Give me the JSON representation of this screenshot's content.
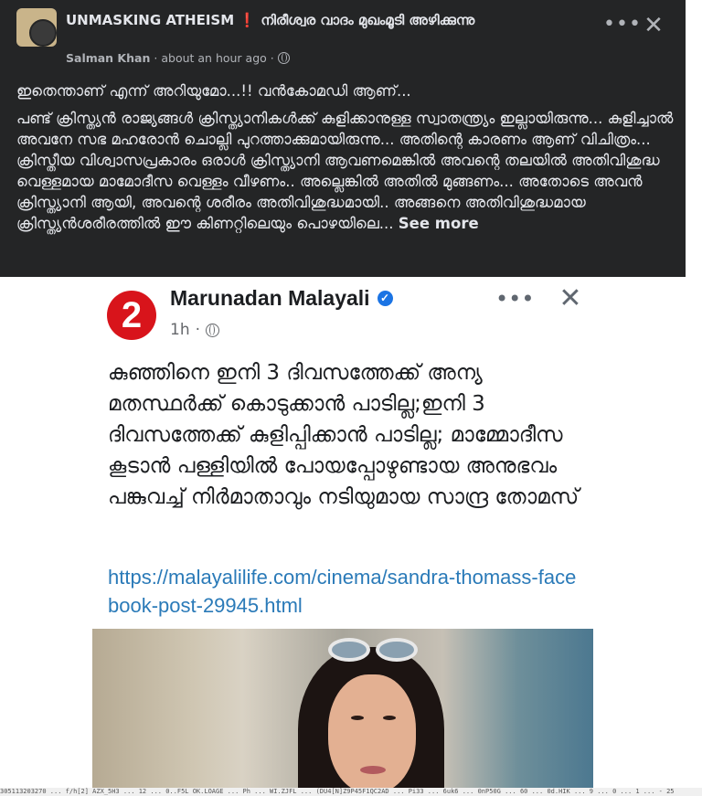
{
  "post": {
    "group_name": "UNMASKING ATHEISM",
    "group_mark": "❗",
    "group_subtitle": "നിരീശ്വര വാദം മുഖംമൂടി അഴിക്കുന്നു",
    "author": "Salman Khan",
    "separator": "·",
    "time": "about an hour ago",
    "line1": "ഇതെന്താണ് എന്ന് അറിയുമോ...!! വൻകോമഡി ആണ്...",
    "body": "പണ്ട് ക്രിസ്ത്യൻ രാജ്യങ്ങൾ ക്രിസ്ത്യാനികൾക്ക് കുളിക്കാനുള്ള സ്വാതന്ത്ര്യം ഇല്ലായിരുന്നു... കുളിച്ചാൽ അവനേ സഭ മഹരോൻ ചൊല്ലി പുറത്താക്കുമായിരുന്നു... അതിന്റെ കാരണം ആണ് വിചിത്രം... ക്രിസ്തീയ വിശ്വാസപ്രകാരം ഒരാൾ ക്രിസ്ത്യാനി ആവണമെങ്കിൽ അവന്റെ തലയിൽ അതിവിശുദ്ധ വെള്ളമായ മാമോദീസ വെള്ളം വീഴണം.. അല്ലെങ്കിൽ അതിൽ മുങ്ങണം... അതോടെ അവൻ ക്രിസ്ത്യാനി ആയി, അവന്റെ ശരീരം അതിവിശുദ്ധമായി.. അങ്ങനെ അതിവിശുദ്ധമായ ക്രിസ്ത്യൻശരീരത്തിൽ ഈ കിണറ്റിലെയും പൊഴയിലെ...",
    "see_more": "See more"
  },
  "card": {
    "logo_text": "2",
    "page_name": "Marunadan Malayali",
    "verified_mark": "✓",
    "time": "1h",
    "separator": "·",
    "headline": "കുഞ്ഞിനെ ഇനി 3 ദിവസത്തേക്ക് അന്യ മതസ്ഥർക്ക് കൊടുക്കാൻ പാടില്ല;ഇനി 3 ദിവസത്തേക്ക് കുളിപ്പിക്കാൻ പാടില്ല; മാമ്മോദീസ കൂടാൻ പള്ളിയിൽ പോയപ്പോഴുണ്ടായ അനുഭവം പങ്കുവച്ച് നിർമാതാവും നടിയുമായ സാന്ദ്ര തോമസ്",
    "link": "https://malayalilife.com/cinema/sandra-thomass-facebook-post-29945.html"
  },
  "footer": "305113203270 ... f/h[2] AZX_5H3 ... 12 ... 0..F5L OK.LOAGE ... Ph ... WI.ZJFL ... (DU4[N]Z9P45F1QC2AD ... Pi33 ... 6uk6 ... 0nP50G ... 60 ... 0d.HIK ... 9 ... 0 ... 1 ... - 25"
}
